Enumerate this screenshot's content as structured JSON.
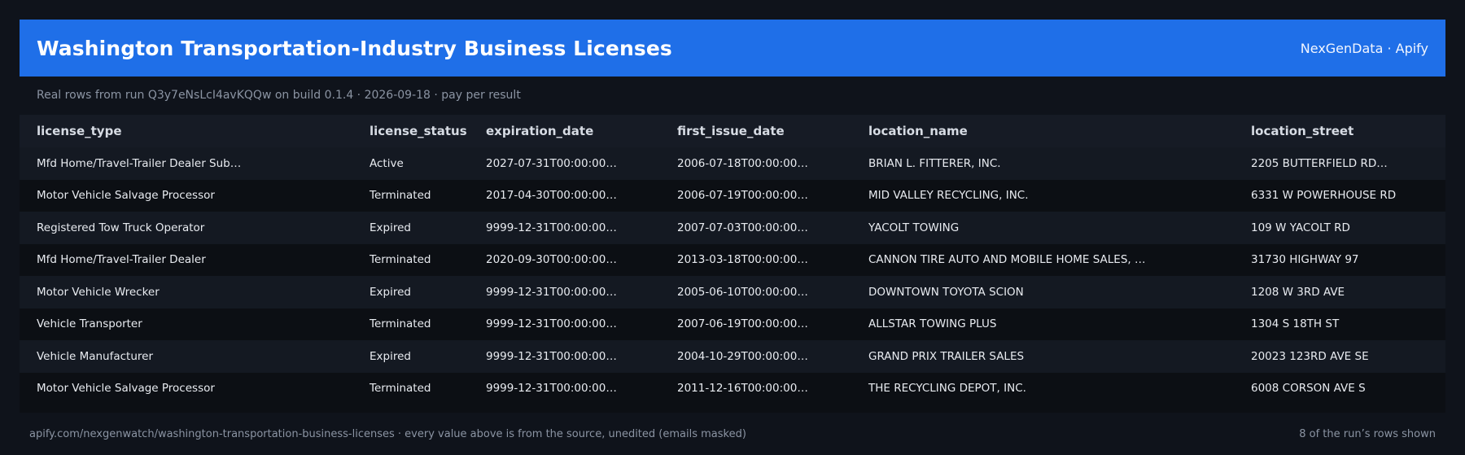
{
  "header": {
    "title": "Washington Transportation-Industry Business Licenses",
    "brand": "NexGenData · Apify"
  },
  "subtitle": "Real rows from run Q3y7eNsLcI4avKQQw on build 0.1.4 · 2026-09-18 · pay per result",
  "table": {
    "columns": [
      "license_type",
      "license_status",
      "expiration_date",
      "first_issue_date",
      "location_name",
      "location_street"
    ],
    "rows": [
      [
        "Mfd Home/Travel-Trailer Dealer Sub…",
        "Active",
        "2027-07-31T00:00:00…",
        "2006-07-18T00:00:00…",
        "BRIAN L. FITTERER, INC.",
        "2205 BUTTERFIELD RD…"
      ],
      [
        "Motor Vehicle Salvage Processor",
        "Terminated",
        "2017-04-30T00:00:00…",
        "2006-07-19T00:00:00…",
        "MID VALLEY RECYCLING, INC.",
        "6331 W POWERHOUSE RD"
      ],
      [
        "Registered Tow Truck Operator",
        "Expired",
        "9999-12-31T00:00:00…",
        "2007-07-03T00:00:00…",
        "YACOLT TOWING",
        "109 W YACOLT RD"
      ],
      [
        "Mfd Home/Travel-Trailer Dealer",
        "Terminated",
        "2020-09-30T00:00:00…",
        "2013-03-18T00:00:00…",
        "CANNON TIRE AUTO AND MOBILE HOME SALES, …",
        "31730 HIGHWAY 97"
      ],
      [
        "Motor Vehicle Wrecker",
        "Expired",
        "9999-12-31T00:00:00…",
        "2005-06-10T00:00:00…",
        "DOWNTOWN TOYOTA SCION",
        "1208 W 3RD AVE"
      ],
      [
        "Vehicle Transporter",
        "Terminated",
        "9999-12-31T00:00:00…",
        "2007-06-19T00:00:00…",
        "ALLSTAR TOWING PLUS",
        "1304 S 18TH ST"
      ],
      [
        "Vehicle Manufacturer",
        "Expired",
        "9999-12-31T00:00:00…",
        "2004-10-29T00:00:00…",
        "GRAND PRIX TRAILER SALES",
        "20023 123RD AVE SE"
      ],
      [
        "Motor Vehicle Salvage Processor",
        "Terminated",
        "9999-12-31T00:00:00…",
        "2011-12-16T00:00:00…",
        "THE RECYCLING DEPOT, INC.",
        "6008 CORSON AVE S"
      ]
    ]
  },
  "footer": {
    "left": "apify.com/nexgenwatch/washington-transportation-business-licenses  ·  every value above is from the source, unedited (emails masked)",
    "right": "8 of the run’s rows shown"
  }
}
